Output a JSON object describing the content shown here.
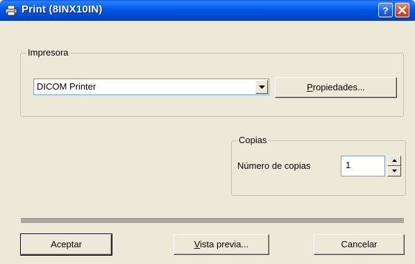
{
  "window": {
    "title": "Print (8INX10IN)",
    "icon": "printer-icon",
    "help_glyph": "?",
    "colors": {
      "titlebar": "#0058e6",
      "face": "#ece9d8"
    }
  },
  "printer_group": {
    "legend": "Impresora",
    "selected_printer": "DICOM Printer",
    "properties_button": {
      "mnemonic": "P",
      "rest": "ropiedades..."
    }
  },
  "copies_group": {
    "legend": "Copias",
    "count_label": "Número de copias",
    "count_value": "1"
  },
  "footer": {
    "accept_label": "Aceptar",
    "preview_button": {
      "mnemonic": "V",
      "rest": "ista previa..."
    },
    "cancel_label": "Cancelar"
  }
}
